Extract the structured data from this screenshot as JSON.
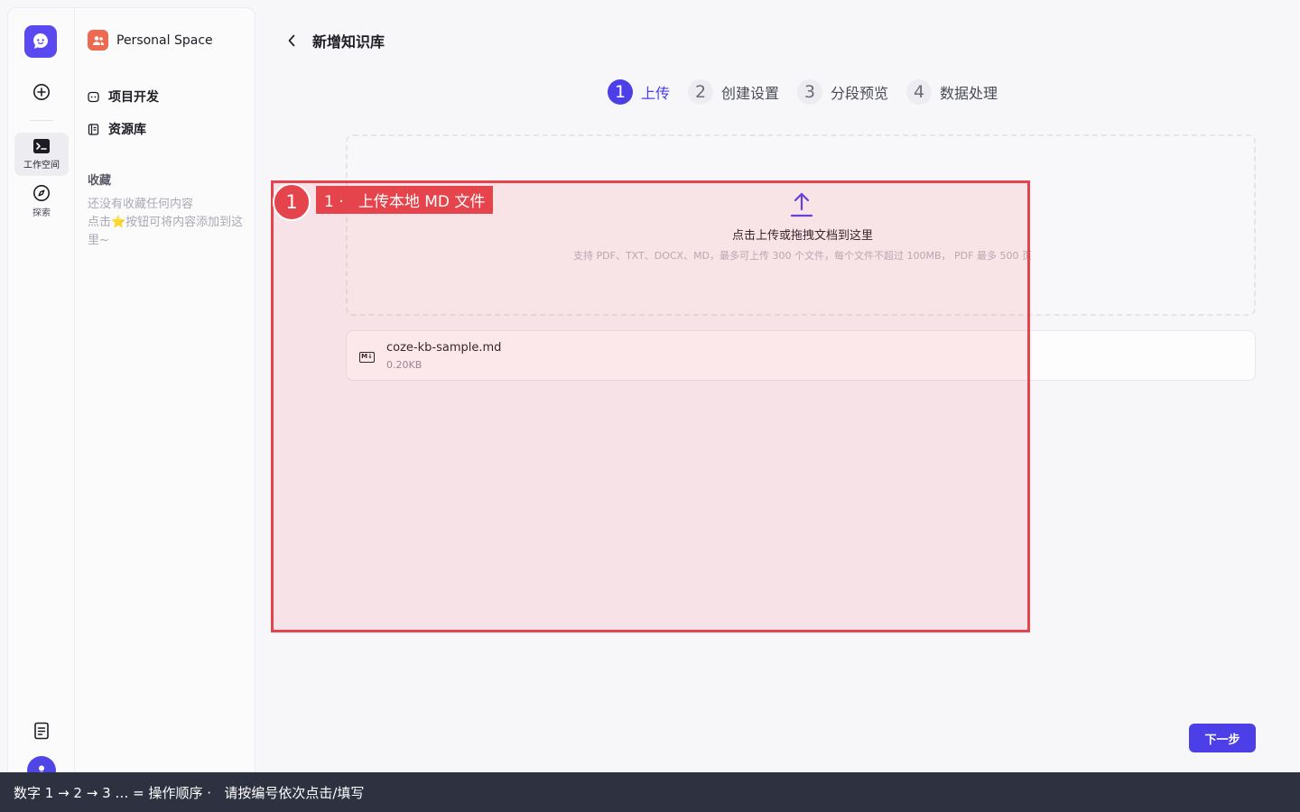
{
  "rail": {
    "workspace_label": "工作空间",
    "explore_label": "探索"
  },
  "sidebar": {
    "space_name": "Personal Space",
    "items": [
      {
        "label": "项目开发",
        "icon": "bot-icon"
      },
      {
        "label": "资源库",
        "icon": "library-icon"
      }
    ],
    "favorites_title": "收藏",
    "favorites_empty_line1": "还没有收藏任何内容",
    "favorites_empty_line2": "点击⭐按钮可将内容添加到这里~"
  },
  "header": {
    "title": "新增知识库"
  },
  "steps": [
    {
      "num": "1",
      "label": "上传",
      "active": true
    },
    {
      "num": "2",
      "label": "创建设置",
      "active": false
    },
    {
      "num": "3",
      "label": "分段预览",
      "active": false
    },
    {
      "num": "4",
      "label": "数据处理",
      "active": false
    }
  ],
  "dropzone": {
    "title": "点击上传或拖拽文档到这里",
    "hint": "支持 PDF、TXT、DOCX、MD，最多可上传 300 个文件，每个文件不超过 100MB， PDF 最多 500 页"
  },
  "file": {
    "icon_text": "M↓",
    "name": "coze-kb-sample.md",
    "size": "0.20KB"
  },
  "actions": {
    "next_label": "下一步"
  },
  "annotation": {
    "number": "1",
    "label": "1 ·   上传本地 MD 文件"
  },
  "bottom_bar": {
    "text": "数字 1 → 2 → 3 … = 操作顺序 ·   请按编号依次点击/填写"
  },
  "colors": {
    "accent": "#4d3fe8",
    "annotation": "#e5444c",
    "space_icon": "#ec6a4f"
  }
}
